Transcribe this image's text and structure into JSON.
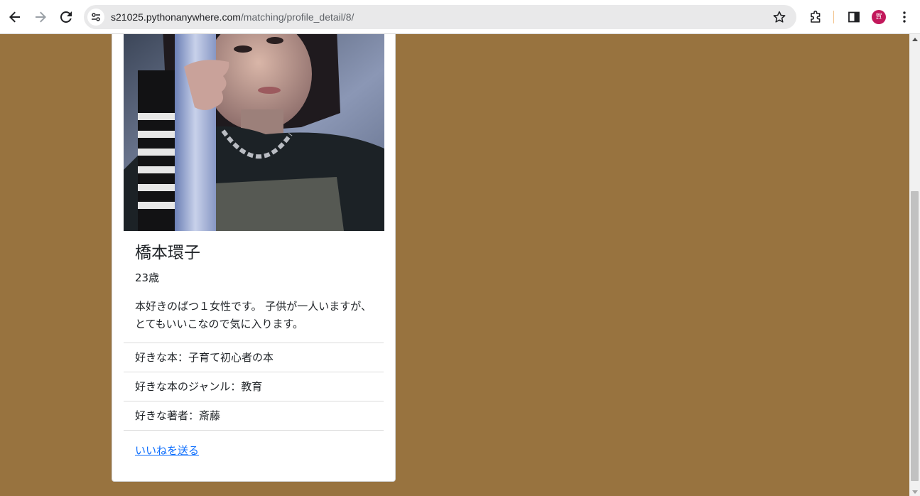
{
  "browser": {
    "url_host": "s21025.pythonanywhere.com",
    "url_path": "/matching/profile_detail/8/",
    "avatar_initial": "賀",
    "accent_color": "#c2185b",
    "icons": [
      "back-icon",
      "forward-icon",
      "reload-icon",
      "site-info-icon",
      "bookmark-star-icon",
      "extensions-icon",
      "side-panel-icon",
      "kebab-menu-icon"
    ]
  },
  "page": {
    "background_color": "#98733f"
  },
  "profile": {
    "photo_alt": "profile-photo",
    "name": "橋本環子",
    "age": "23歳",
    "intro": "本好きのばつ１女性です。 子供が一人いますが、とてもいいこなので気に入ります。",
    "details": [
      {
        "text": "好きな本：子育て初心者の本"
      },
      {
        "text": "好きな本のジャンル：教育"
      },
      {
        "text": "好きな著者：斎藤"
      }
    ],
    "like_link": "いいねを送る",
    "link_color": "#0d6efd"
  }
}
